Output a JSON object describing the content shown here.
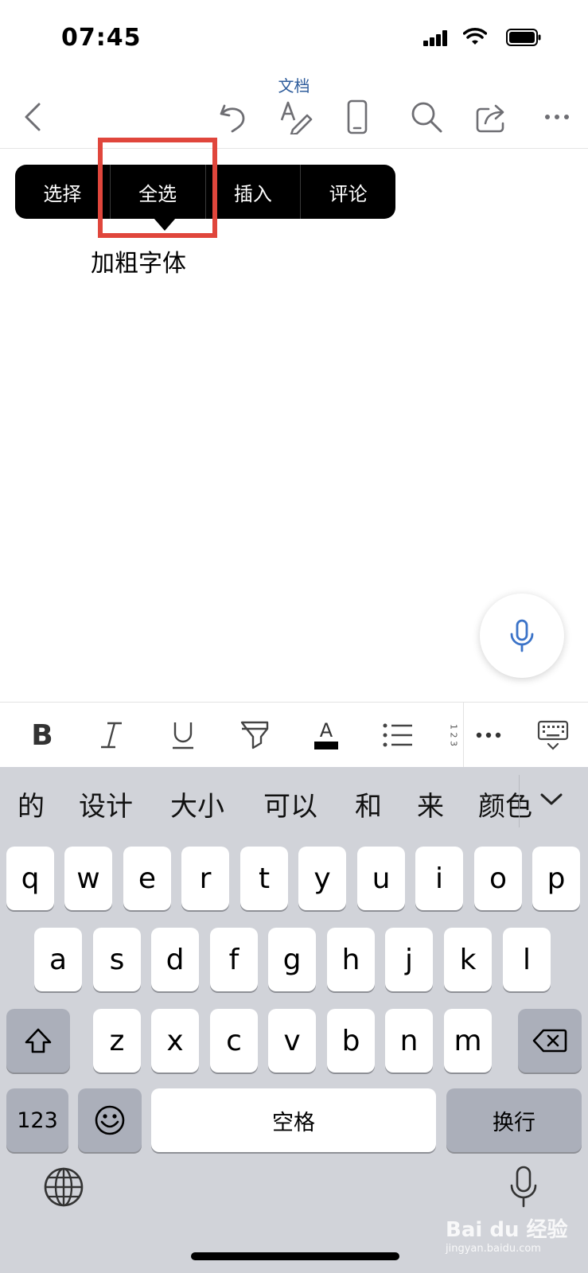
{
  "status_bar": {
    "time": "07:45"
  },
  "nav": {
    "title": "文档"
  },
  "context_menu": {
    "items": [
      "选择",
      "全选",
      "插入",
      "评论"
    ]
  },
  "document": {
    "text": "加粗字体"
  },
  "format_toolbar": {
    "bold": "B",
    "italic": "I",
    "underline": "U",
    "font_color_letter": "A",
    "numbered_list_glyphs": "1 2 3"
  },
  "keyboard": {
    "candidates": [
      "的",
      "设计",
      "大小",
      "可以",
      "和",
      "来",
      "颜色"
    ],
    "row1": [
      "q",
      "w",
      "e",
      "r",
      "t",
      "y",
      "u",
      "i",
      "o",
      "p"
    ],
    "row2": [
      "a",
      "s",
      "d",
      "f",
      "g",
      "h",
      "j",
      "k",
      "l"
    ],
    "row3": [
      "z",
      "x",
      "c",
      "v",
      "b",
      "n",
      "m"
    ],
    "numbers_key": "123",
    "space_key": "空格",
    "return_key": "换行"
  },
  "watermark": {
    "brand": "Bai du 经验",
    "url": "jingyan.baidu.com"
  },
  "colors": {
    "accent": "#2f5d9c",
    "highlight_box": "#e0463c",
    "keyboard_bg": "#d1d3d9"
  }
}
